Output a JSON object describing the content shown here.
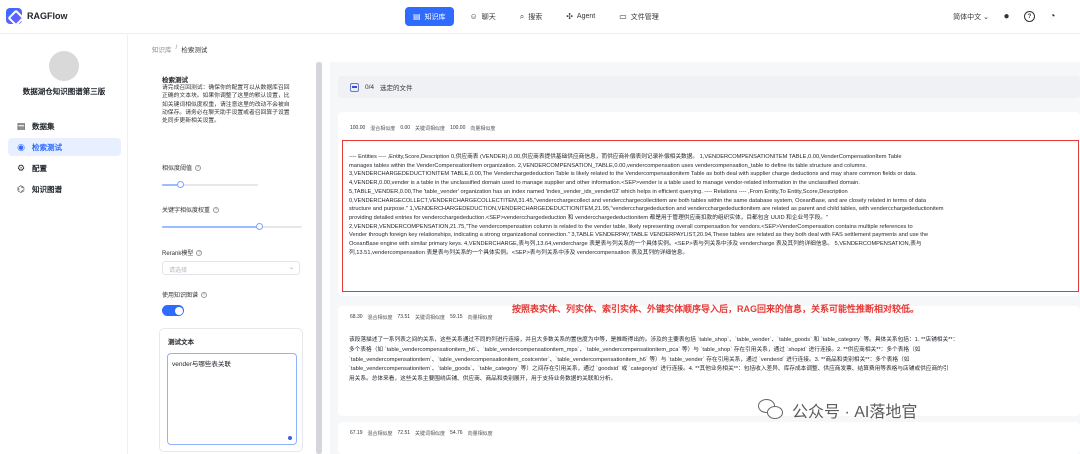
{
  "app": {
    "name": "RAGFlow"
  },
  "nav": {
    "items": [
      {
        "label": "知识库",
        "icon": "database-icon",
        "glyph": "▤",
        "active": true
      },
      {
        "label": "聊天",
        "icon": "chat-icon",
        "glyph": "☺",
        "active": false
      },
      {
        "label": "搜索",
        "icon": "search-icon",
        "glyph": "⌕",
        "active": false
      },
      {
        "label": "Agent",
        "icon": "agent-icon",
        "glyph": "✣",
        "active": false
      },
      {
        "label": "文件管理",
        "icon": "file-icon",
        "glyph": "▭",
        "active": false
      }
    ],
    "language": "简体中文",
    "language_chevron": "⌄",
    "github_glyph": "●",
    "help_glyph": "?",
    "settings_glyph": "◔"
  },
  "sidebar": {
    "kb_name": "数据湖仓知识图谱第三版",
    "items": [
      {
        "label": "数据集",
        "glyph": "▤",
        "active": false
      },
      {
        "label": "检索测试",
        "glyph": "◉",
        "active": true
      },
      {
        "label": "配置",
        "glyph": "⚙",
        "active": false
      },
      {
        "label": "知识图谱",
        "glyph": "⌬",
        "active": false
      }
    ]
  },
  "breadcrumb": {
    "root": "知识库",
    "sep": "/",
    "current": "检索测试"
  },
  "settings": {
    "title": "检索测试",
    "description": "请完成召回测试：确保你的配置可以从数据库召回正确的文本块。如果你调整了这里的默认设置，比如关键词相似度权重，请注意这里的改动不会被自动保存。请务必在聊天助手设置或者召回算子设置处同步更新相关设置。",
    "similarity_label": "相似度阈值",
    "keyword_weight_label": "关键字相似度权重",
    "rerank_label": "Rerank模型",
    "rerank_placeholder": "请选择",
    "rerank_chevron": "⌄",
    "kg_label": "使用知识图谱",
    "use_kg": true,
    "similarity_value": 0.2,
    "keyword_weight_value": 0.7,
    "test_title": "测试文本",
    "test_text": "vender与哪些表关联"
  },
  "results": {
    "selected": "0/4",
    "selected_suffix": "选定的文件",
    "chunks": [
      {
        "hybrid": "100.00",
        "hybrid_label": "混合相似度",
        "keyword": "0.00",
        "keyword_label": "关键词相似度",
        "vector": "100.00",
        "vector_label": "向量相似度",
        "lines": [
          "---- Entities ---- ,Entity,Score,Description 0,供应商表 (VENDER),0.00,供应商表提供基础供应商信息，而供应商补偿表则记录补偿相关数据。 1,VENDERCOMPENSATIONITEM TABLE,0.00,VenderCompensationItem Table",
          "manages tables within the VenderCompensationItem organization. 2,VENDERCOMPENSATION_TABLE,0.00,vendercompensation uses vendercompensation_table to define its table structure and columns.",
          "3,VENDERCHARGEDEDUCTIONITEM TABLE,0.00,The Venderchargededuction Table is likely related to the Vendercompensationitem Table as both deal with supplier charge deductions and may share common fields or data.",
          "4,VENDER,0.00,vender is a table in the unclassified domain used to manage supplier and other information.<SEP>vender is a table used to manage vendor-related information in the unclassified domain.",
          "5,TABLE_VENDER,0.00,The 'table_vender' organization has an index named 'index_vender_idx_vender02' which helps in efficient querying. ---- Relations ---- ,From Entity,To Entity,Score,Description",
          "0,VENDERCHARGECOLLECT,VENDERCHARGECOLLECTITEM,31.45,\"vendercchargecollect and vendercchargecollectitem are both tables within the same database system, OceanBase, and are closely related in terms of data",
          "structure and purpose.\" 1,VENDERCHARGEDEDUCTION,VENDERCHARGEDEDUCTIONITEM,21.95,\"vendercchargededuction and vendercchargedeductionitem are related as parent and child tables, with vendercchargedeductionitem",
          "providing detailed entries for vendercchargededuction.<SEP>vendercchargededuction 和 vendercchargedeductionitem 都是用于管理供应商扣款的组织实体，目都包含 UUID 和企业号字段。\"",
          "2,VENDER,VENDERCOMPENSATION,21.75,\"The vendercompensation column is related to the vender table, likely representing overall compensation for vendors.<SEP>VenderCompensation contains multiple references to",
          "Vender through foreign key relationships, indicating a strong organizational connection.\" 3,TABLE VENDERPAY,TABLE VENDERPAYLIST,20.94,These tables are related as they both deal with FAS settlement payments and use the",
          "OceanBase engine with similar primary keys. 4,VENDERCHARGE,表与列,13.64,vendercharge 表是表与列关系的一个具体实例。<SEP>表与列关系中涉及 vendercharge 表及其列的详细信息。 5,VENDERCOMPENSATION,表与",
          "列,13.51,vendercompensation 表是表与列关系的一个具体实例。<SEP>表与列关系中涉及 vendercompensation 表及其列的详细信息。"
        ]
      },
      {
        "hybrid": "68.30",
        "hybrid_label": "混合相似度",
        "keyword": "73.51",
        "keyword_label": "关键词相似度",
        "vector": "59.15",
        "vector_label": "向量相似度",
        "lines": [
          "该段落描述了一系列表之间的关系，这些关系通过不同的列进行连接，并且大多数关系的置信度为中等，是推断得出的。涉及的主要表包括 `table_shop`、`table_vender`、`table_goods` 和 `table_category` 等。具体关系包括：1. **店铺相关**：",
          "多个表格（如 `table_vendercompensationitem_h6`、`table_vendercompensationitem_mps`、`table_vendercompensationitem_pca` 等）与 `table_shop` 存在引用关系，通过 `shopid` 进行连接。2. **供应商相关**：多个表格（如",
          "`table_vendercompensationitem`、`table_vendercompensationitem_costcenter`、`table_vendercompensationitem_h6` 等）与 `table_vender` 存在引用关系，通过 `venderid` 进行连接。3. **商品和类别相关**：多个表格（如",
          "`table_vendercompensationitem`、`table_goods`、`table_category` 等）之间存在引用关系，通过 `goodsid` 或 `categoryid` 进行连接。4. **其他业务相关**：包括收入差异、库存成本调整、供应商发票、结算费用等表格与店铺或供应商的引",
          "用关系。总体来看，这些关系主要围绕店铺、供应商、商品和类别展开，用于支持业务数据的关联和分析。"
        ]
      },
      {
        "hybrid": "67.19",
        "hybrid_label": "混合相似度",
        "keyword": "72.51",
        "keyword_label": "关键词相似度",
        "vector": "54.76",
        "vector_label": "向量相似度",
        "lines": []
      }
    ]
  },
  "annotation": "按照表实体、列实体、索引实体、外键实体顺序导入后，RAG回来的信息，关系可能性推断相对较低。",
  "watermark": {
    "text": "公众号 · AI落地官"
  }
}
